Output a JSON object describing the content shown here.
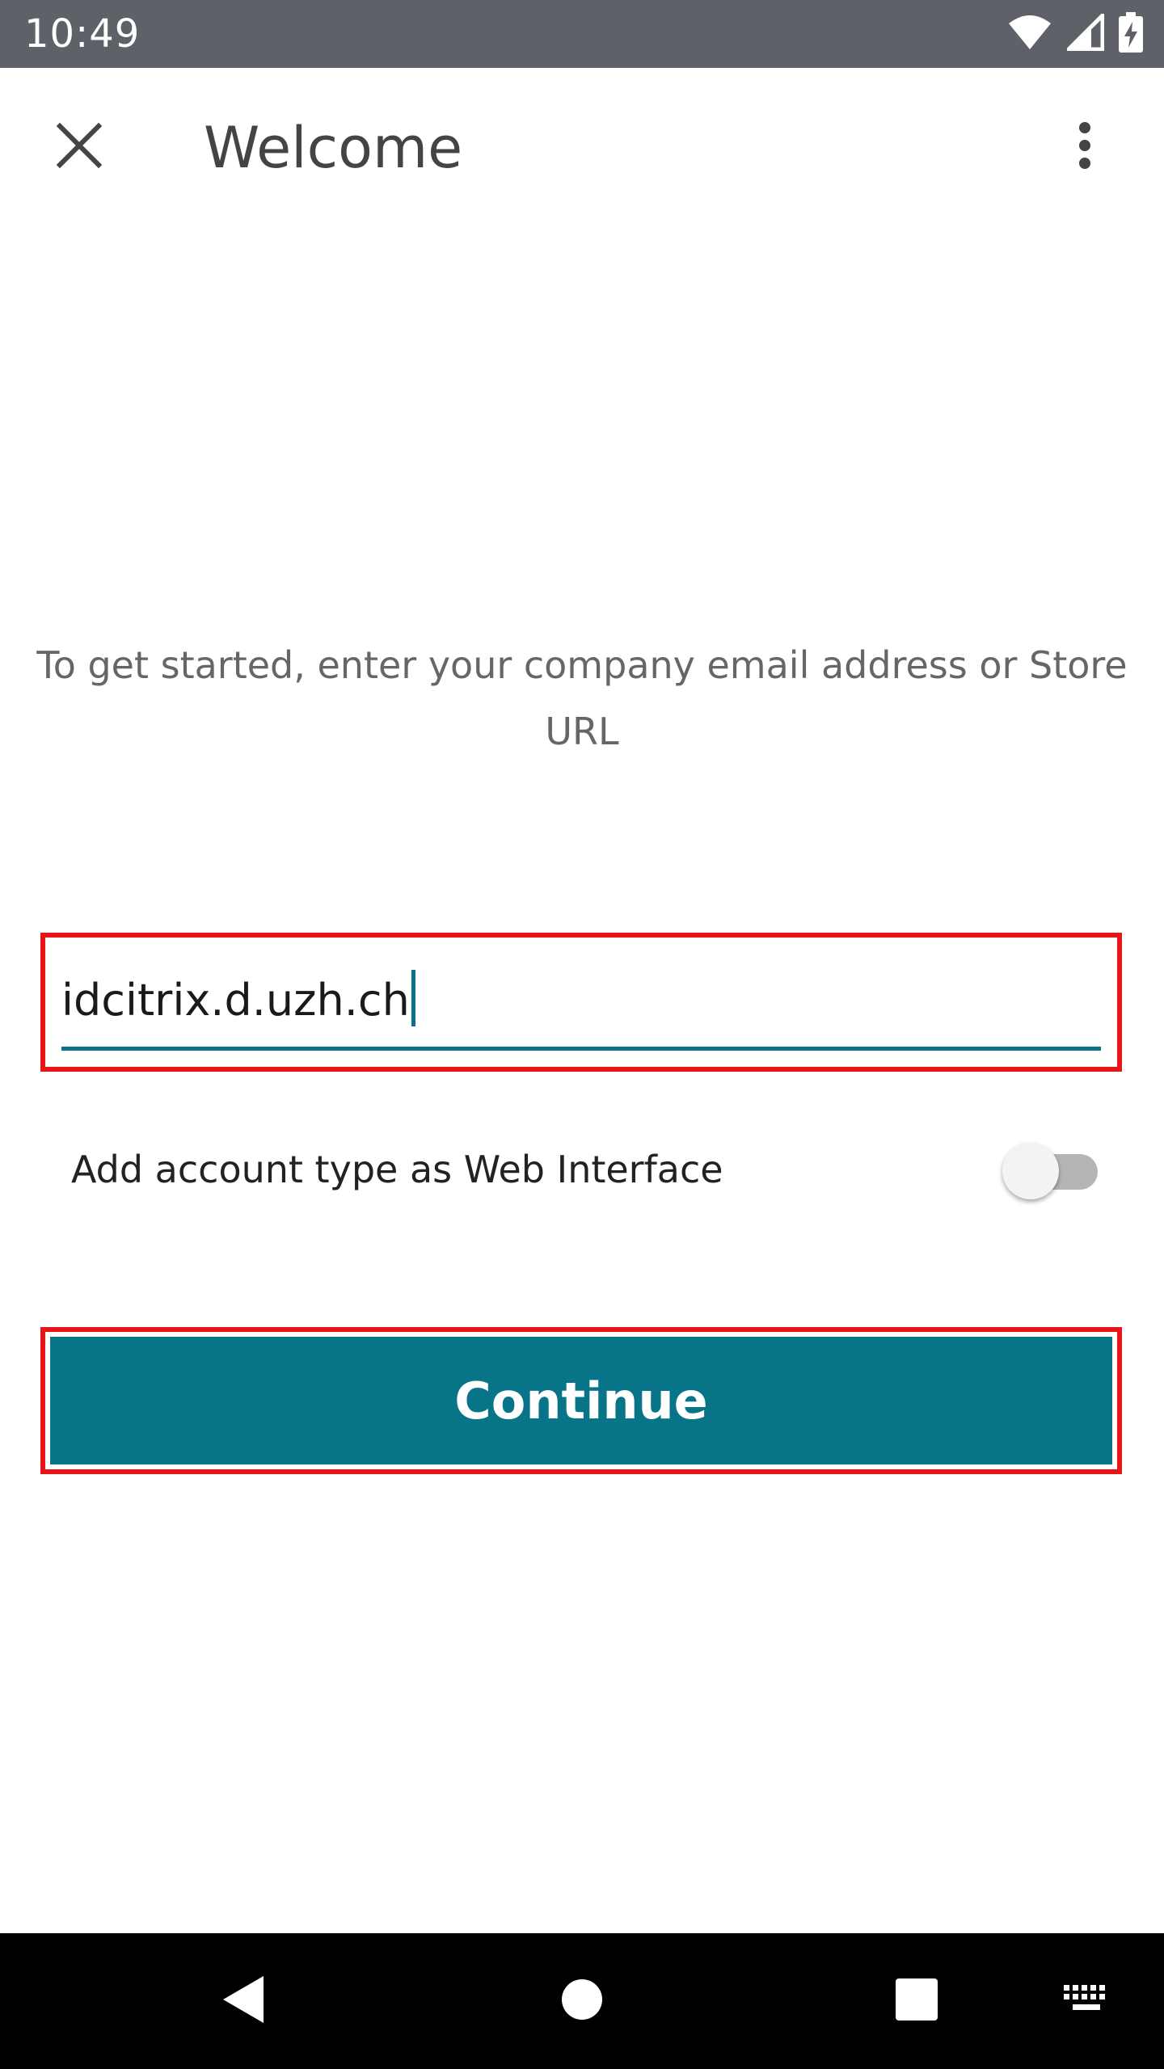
{
  "status_bar": {
    "time": "10:49",
    "icons": [
      "wifi-icon",
      "cell-signal-icon",
      "battery-charging-icon"
    ]
  },
  "app_bar": {
    "title": "Welcome",
    "close_icon": "close-icon",
    "overflow_icon": "more-vert-icon"
  },
  "main": {
    "prompt": "To get started, enter your company email address or Store URL",
    "url_input": {
      "value": "idcitrix.d.uzh.ch",
      "accent_color": "#0a7285"
    },
    "toggle": {
      "label": "Add account type as Web Interface",
      "checked": false
    },
    "continue_label": "Continue"
  },
  "nav_bar": {
    "icons": [
      "back-icon",
      "home-icon",
      "recents-icon",
      "keyboard-icon"
    ]
  },
  "colors": {
    "primary": "#077487",
    "highlight_border": "#e8141a",
    "status_bar": "#5f6169"
  }
}
